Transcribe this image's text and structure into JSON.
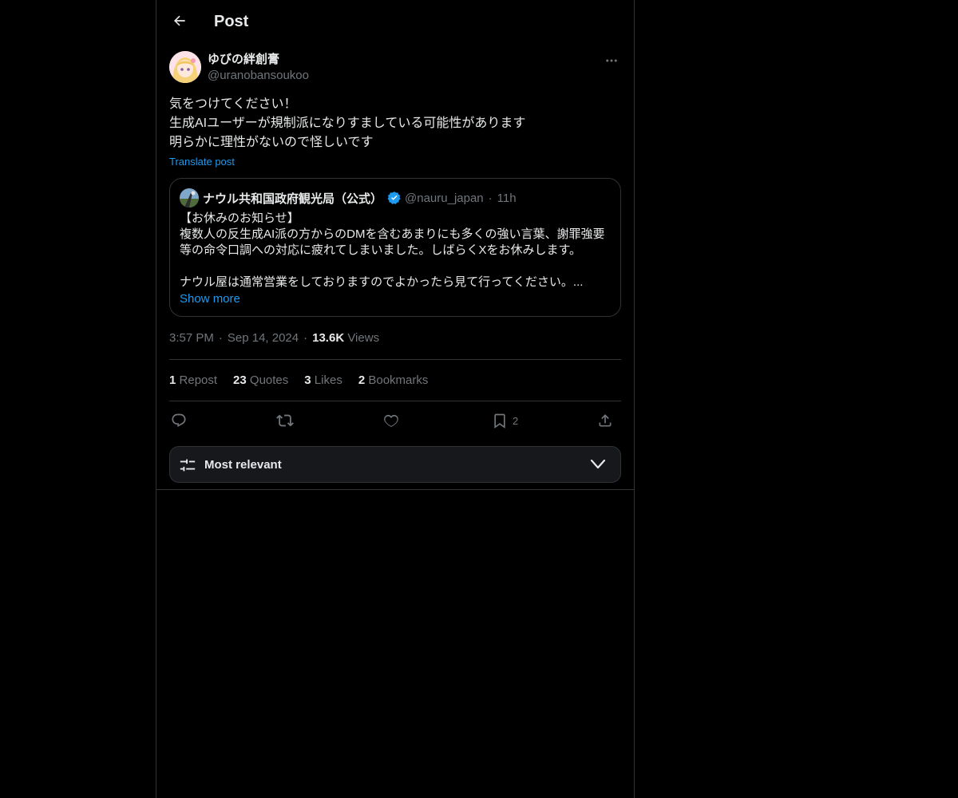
{
  "header": {
    "title": "Post"
  },
  "author": {
    "name": "ゆびの絆創膏",
    "handle": "@uranobansoukoo"
  },
  "post": {
    "lines": [
      "気をつけてください！",
      "生成AIユーザーが規制派になりすましている可能性があります",
      "明らかに理性がないので怪しいです"
    ],
    "translate_label": "Translate post"
  },
  "quote": {
    "name": "ナウル共和国政府観光局（公式）",
    "handle": "@nauru_japan",
    "dot": "·",
    "time": "11h",
    "lines": [
      "【お休みのお知らせ】",
      "複数人の反生成AI派の方からのDMを含むあまりにも多くの強い言葉、謝罪強要",
      "等の命令口調への対応に疲れてしまいました。しばらくXをお休みします。",
      "",
      "ナウル屋は通常営業をしておりますのでよかったら見て行ってください。..."
    ],
    "show_more_label": "Show more"
  },
  "meta": {
    "time": "3:57 PM",
    "sep": "·",
    "date": "Sep 14, 2024",
    "views_count": "13.6K",
    "views_label": "Views"
  },
  "stats": {
    "reposts": {
      "count": "1",
      "label": "Repost"
    },
    "quotes": {
      "count": "23",
      "label": "Quotes"
    },
    "likes": {
      "count": "3",
      "label": "Likes"
    },
    "bookmarks": {
      "count": "2",
      "label": "Bookmarks"
    }
  },
  "actions": {
    "reply_icon": "reply-icon",
    "repost_icon": "repost-icon",
    "like_icon": "heart-icon",
    "bookmark_icon": "bookmark-icon",
    "bookmark_count": "2",
    "share_icon": "share-icon"
  },
  "sort": {
    "label": "Most relevant"
  },
  "colors": {
    "background": "#000000",
    "text": "#e7e9ea",
    "muted": "#71767b",
    "accent": "#1d9bf0",
    "border": "#2f3336",
    "sort_bg": "#16181c"
  }
}
